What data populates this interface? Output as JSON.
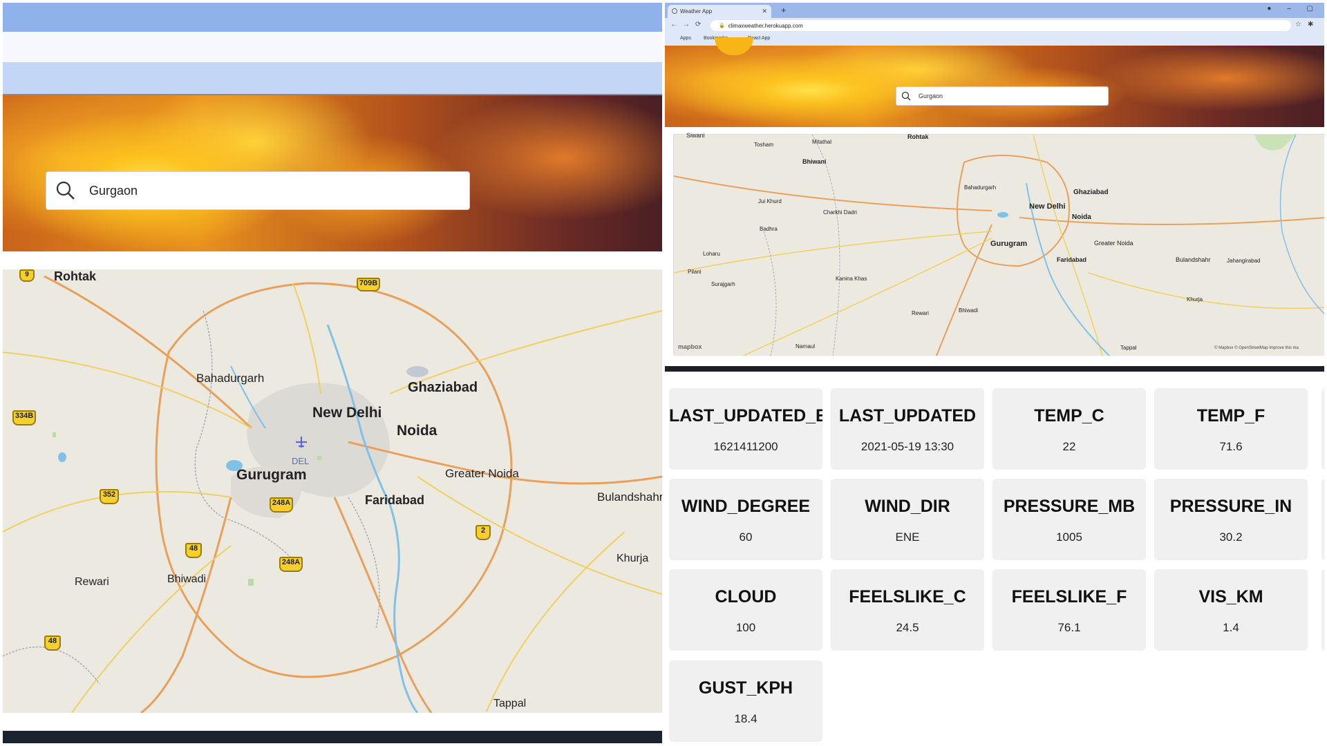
{
  "left_panel": {
    "search": {
      "value": "Gurgaon",
      "icon": "search-icon"
    },
    "map": {
      "labels": [
        {
          "text": "Rohtak",
          "big": false
        },
        {
          "text": "Bahadurgarh",
          "big": false
        },
        {
          "text": "Ghaziabad",
          "big": true
        },
        {
          "text": "New Delhi",
          "big": true
        },
        {
          "text": "Noida",
          "big": true
        },
        {
          "text": "DEL",
          "big": false
        },
        {
          "text": "Gurugram",
          "big": true
        },
        {
          "text": "Greater Noida",
          "big": false
        },
        {
          "text": "Faridabad",
          "big": true
        },
        {
          "text": "Bulandshahr",
          "big": false
        },
        {
          "text": "Khurja",
          "big": false
        },
        {
          "text": "Rewari",
          "big": false
        },
        {
          "text": "Bhiwadi",
          "big": false
        },
        {
          "text": "Tappal",
          "big": false
        }
      ],
      "shields": [
        "9",
        "709B",
        "334B",
        "352",
        "248A",
        "48",
        "248A",
        "2",
        "48"
      ]
    }
  },
  "right_panel": {
    "browser": {
      "tab_title": "Weather App",
      "new_tab": "+",
      "url": "climaxweather.herokuapp.com",
      "bookmarks": [
        "Apps",
        "Bookmarks",
        "React App"
      ]
    },
    "search": {
      "value": "Gurgaon",
      "icon": "search-icon"
    },
    "map": {
      "labels": [
        "Siwani",
        "Rohtak",
        "Tosham",
        "Mitathal",
        "Bhiwani",
        "Bahadurgarh",
        "Ghaziabad",
        "New Delhi",
        "Noida",
        "Jui Khurd",
        "Charkhi Dadri",
        "Badhra",
        "Gurugram",
        "Greater Noida",
        "Faridabad",
        "Bulandshahr",
        "Jahangirabad",
        "Loharu",
        "Kanina Khas",
        "Pilani",
        "Surajgarh",
        "Rewari",
        "Bhiwadi",
        "Khurja",
        "Narnaul",
        "Tappal"
      ],
      "attribution_logo": "mapbox",
      "attribution_text": "© Mapbox © OpenStreetMap Improve this ma"
    },
    "weather_cards": [
      {
        "key": "LAST_UPDATED_EPOCH",
        "value": "1621411200"
      },
      {
        "key": "LAST_UPDATED",
        "value": "2021-05-19 13:30"
      },
      {
        "key": "TEMP_C",
        "value": "22"
      },
      {
        "key": "TEMP_F",
        "value": "71.6"
      },
      {
        "key": "WIND_DEGREE",
        "value": "60"
      },
      {
        "key": "WIND_DIR",
        "value": "ENE"
      },
      {
        "key": "PRESSURE_MB",
        "value": "1005"
      },
      {
        "key": "PRESSURE_IN",
        "value": "30.2"
      },
      {
        "key": "CLOUD",
        "value": "100"
      },
      {
        "key": "FEELSLIKE_C",
        "value": "24.5"
      },
      {
        "key": "FEELSLIKE_F",
        "value": "76.1"
      },
      {
        "key": "VIS_KM",
        "value": "1.4"
      },
      {
        "key": "GUST_KPH",
        "value": "18.4"
      }
    ]
  }
}
